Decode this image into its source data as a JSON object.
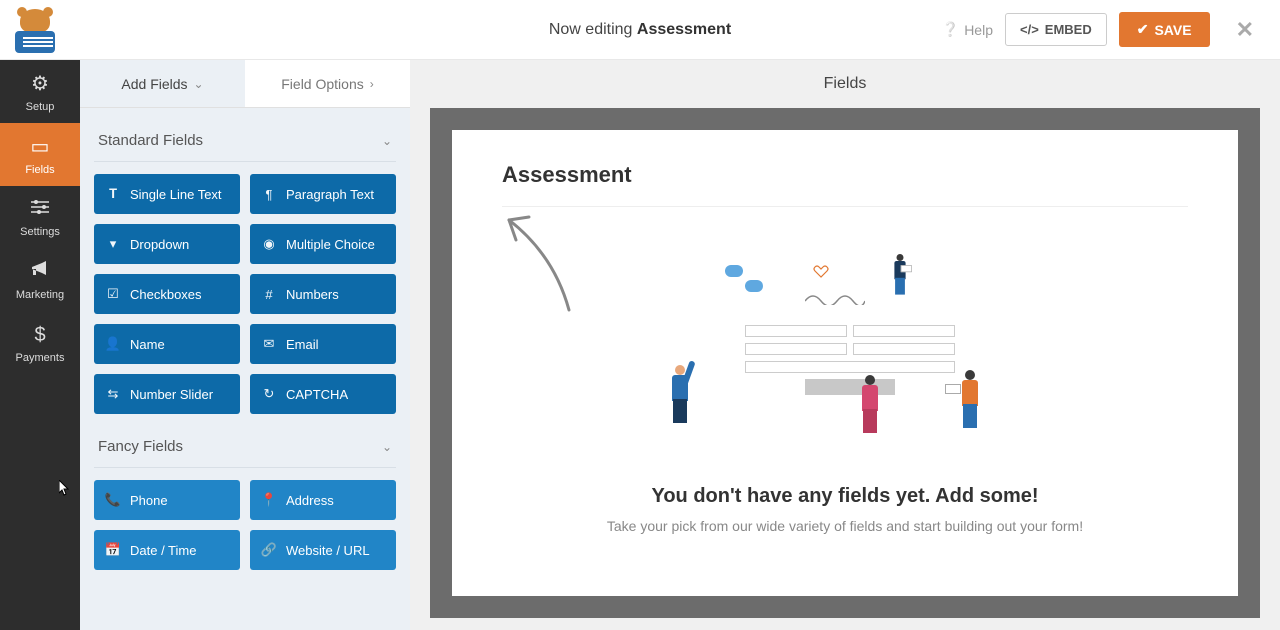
{
  "topbar": {
    "editing_prefix": "Now editing ",
    "editing_name": "Assessment",
    "help": "Help",
    "embed": "EMBED",
    "save": "SAVE"
  },
  "nav": {
    "setup": "Setup",
    "fields": "Fields",
    "settings": "Settings",
    "marketing": "Marketing",
    "payments": "Payments"
  },
  "panel": {
    "tab_add": "Add Fields",
    "tab_options": "Field Options",
    "group_standard": "Standard Fields",
    "group_fancy": "Fancy Fields",
    "standard": {
      "single_line": "Single Line Text",
      "paragraph": "Paragraph Text",
      "dropdown": "Dropdown",
      "multiple_choice": "Multiple Choice",
      "checkboxes": "Checkboxes",
      "numbers": "Numbers",
      "name": "Name",
      "email": "Email",
      "number_slider": "Number Slider",
      "captcha": "CAPTCHA"
    },
    "fancy": {
      "phone": "Phone",
      "address": "Address",
      "date_time": "Date / Time",
      "website": "Website / URL"
    }
  },
  "preview": {
    "header": "Fields",
    "form_title": "Assessment",
    "empty_title": "You don't have any fields yet. Add some!",
    "empty_sub": "Take your pick from our wide variety of fields and start building out your form!"
  },
  "colors": {
    "accent": "#e27730",
    "field_btn": "#0d6aa8",
    "nav_bg": "#2d2d2d"
  }
}
